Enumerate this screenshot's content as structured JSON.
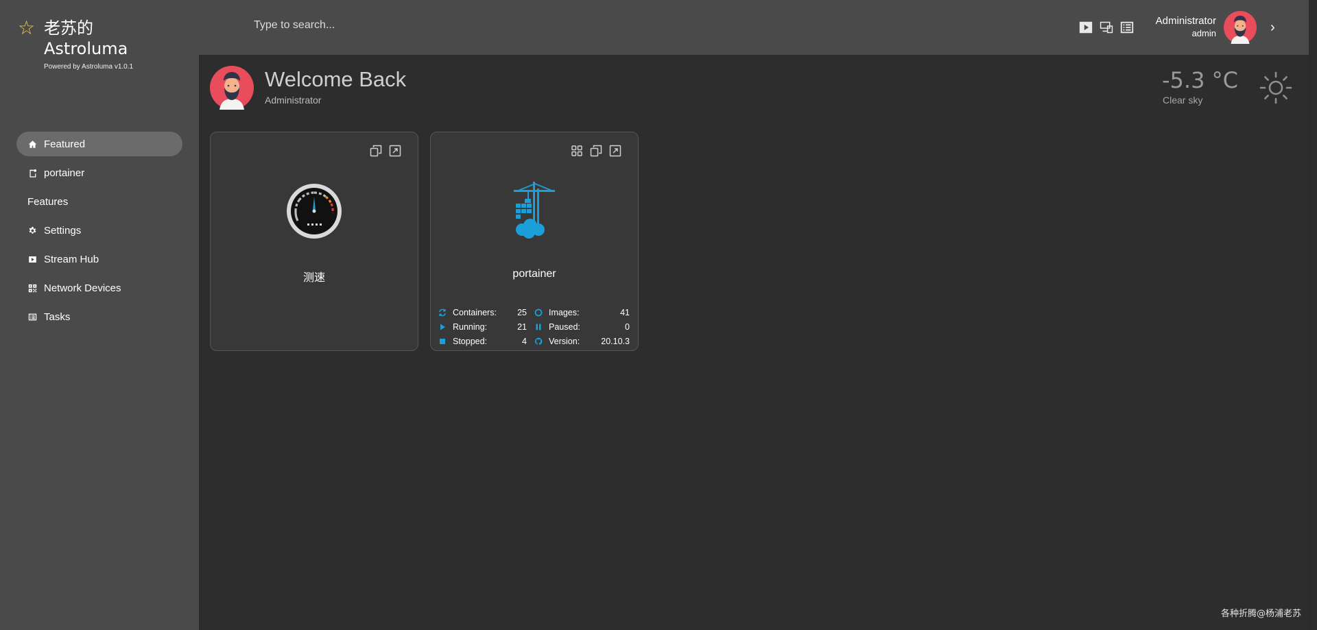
{
  "brand": {
    "name_line1": "老苏的",
    "name_line2": "Astroluma",
    "powered_by": "Powered by Astroluma v1.0.1"
  },
  "sidebar": {
    "items": [
      {
        "label": "Featured",
        "icon": "home-icon",
        "active": true
      },
      {
        "label": "portainer",
        "icon": "page-icon",
        "active": false
      }
    ],
    "features_heading": "Features",
    "features": [
      {
        "label": "Settings",
        "icon": "gear-icon"
      },
      {
        "label": "Stream Hub",
        "icon": "play-icon"
      },
      {
        "label": "Network Devices",
        "icon": "grid-icon"
      },
      {
        "label": "Tasks",
        "icon": "list-icon"
      }
    ]
  },
  "topbar": {
    "search_placeholder": "Type to search...",
    "user_name": "Administrator",
    "user_role": "admin"
  },
  "welcome": {
    "title": "Welcome Back",
    "subtitle": "Administrator"
  },
  "weather": {
    "temperature": "-5.3 °C",
    "description": "Clear sky"
  },
  "cards": [
    {
      "title": "测速",
      "logo": "speedometer-icon"
    },
    {
      "title": "portainer",
      "logo": "portainer-icon",
      "stats": {
        "containers_label": "Containers:",
        "containers": "25",
        "images_label": "Images:",
        "images": "41",
        "running_label": "Running:",
        "running": "21",
        "paused_label": "Paused:",
        "paused": "0",
        "stopped_label": "Stopped:",
        "stopped": "4",
        "version_label": "Version:",
        "version": "20.10.3"
      }
    }
  ],
  "colors": {
    "accent_blue": "#1a9fd9",
    "sidebar_bg": "#4a4a4a",
    "main_bg": "#2d2d2d",
    "star": "#f2c94c"
  },
  "watermark": "各种折腾@杨浦老苏"
}
